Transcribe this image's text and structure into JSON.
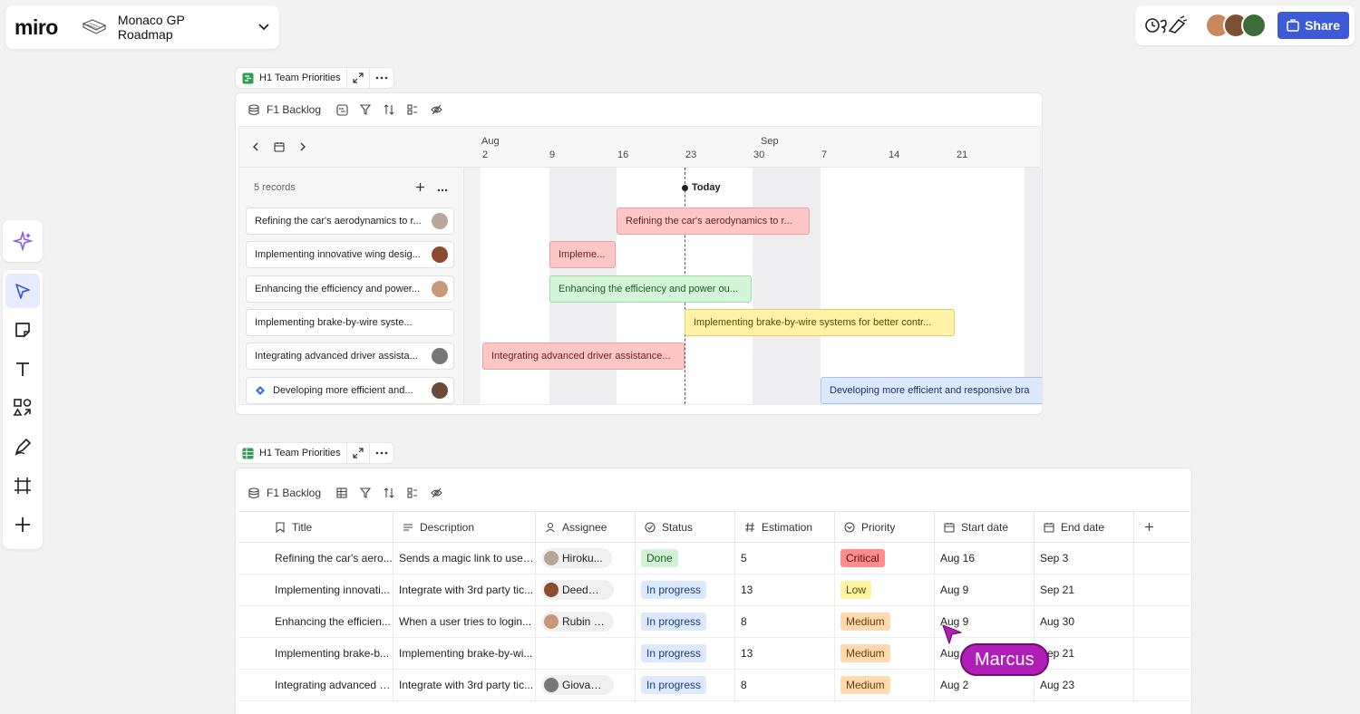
{
  "app": {
    "logo": "miro",
    "board_title": "Monaco GP Roadmap",
    "share_label": "Share",
    "collaborators": [
      {
        "color": "#c9885e"
      },
      {
        "color": "#7a5132"
      },
      {
        "color": "#3e6b3a"
      }
    ]
  },
  "toolbar": {
    "tools": [
      {
        "name": "select",
        "active": true
      },
      {
        "name": "sticky-note"
      },
      {
        "name": "text"
      },
      {
        "name": "shapes"
      },
      {
        "name": "pen"
      },
      {
        "name": "frame"
      },
      {
        "name": "add"
      }
    ]
  },
  "timeline": {
    "widget_title": "H1 Team Priorities",
    "source": "F1 Backlog",
    "records_label": "5 records",
    "months": [
      {
        "label": "Aug"
      },
      {
        "label": "Sep"
      }
    ],
    "days": [
      "2",
      "9",
      "16",
      "23",
      "30",
      "7",
      "14",
      "21"
    ],
    "today_label": "Today",
    "records": [
      {
        "title": "Refining the car's aerodynamics to r...",
        "avatar": "#b8a89a"
      },
      {
        "title": "Implementing innovative wing desig...",
        "avatar": "#8a4b2e"
      },
      {
        "title": "Enhancing the efficiency and power...",
        "avatar": "#c99a7a"
      },
      {
        "title": "Implementing brake-by-wire syste..."
      },
      {
        "title": "Integrating advanced driver assista...",
        "avatar": "#777777"
      },
      {
        "title": "Developing more efficient and...",
        "avatar": "#6a4a3a",
        "jira": true
      }
    ],
    "bars": [
      {
        "label": "Refining the car's aerodynamics to r...",
        "color": "red"
      },
      {
        "label": "Impleme...",
        "color": "red"
      },
      {
        "label": "Enhancing the efficiency and power ou...",
        "color": "green"
      },
      {
        "label": "Implementing brake-by-wire systems for better contr...",
        "color": "yellow"
      },
      {
        "label": "Integrating advanced driver assistance...",
        "color": "red"
      },
      {
        "label": "Developing more efficient and responsive bra",
        "color": "blue"
      }
    ]
  },
  "table": {
    "widget_title": "H1 Team Priorities",
    "source": "F1 Backlog",
    "columns": [
      "Title",
      "Description",
      "Assignee",
      "Status",
      "Estimation",
      "Priority",
      "Start date",
      "End date"
    ],
    "rows": [
      {
        "title": "Refining the car's aero...",
        "description": "Sends a magic link to user...",
        "assignee": "Hiroku...",
        "avatar": "#b5a597",
        "status": "Done",
        "status_kind": "done",
        "estimation": "5",
        "priority": "Critical",
        "priority_kind": "crit",
        "start": "Aug 16",
        "end": "Sep 3"
      },
      {
        "title": "Implementing innovati...",
        "description": "Integrate with 3rd party tic...",
        "assignee": "Deedee...",
        "avatar": "#8a4b2e",
        "status": "In progress",
        "status_kind": "prog",
        "estimation": "13",
        "priority": "Low",
        "priority_kind": "low",
        "start": "Aug 9",
        "end": "Sep 21"
      },
      {
        "title": "Enhancing the efficien...",
        "description": "When a user tries to login...",
        "assignee": "Rubin Ko...",
        "avatar": "#c99a7a",
        "status": "In progress",
        "status_kind": "prog",
        "estimation": "8",
        "priority": "Medium",
        "priority_kind": "med",
        "start": "Aug 9",
        "end": "Aug 30"
      },
      {
        "title": "Implementing brake-b...",
        "description": "Implementing brake-by-wi...",
        "assignee": "",
        "status": "In progress",
        "status_kind": "prog",
        "estimation": "13",
        "priority": "Medium",
        "priority_kind": "med",
        "start": "Aug 2",
        "end": "Sep 21"
      },
      {
        "title": "Integrating advanced d...",
        "description": "Integrate with 3rd party tic...",
        "assignee": "Giovanni...",
        "avatar": "#777777",
        "status": "In progress",
        "status_kind": "prog",
        "estimation": "8",
        "priority": "Medium",
        "priority_kind": "med",
        "start": "Aug 2",
        "end": "Aug 23"
      }
    ]
  },
  "cursor": {
    "name": "Marcus",
    "color": "#b01fb5"
  }
}
